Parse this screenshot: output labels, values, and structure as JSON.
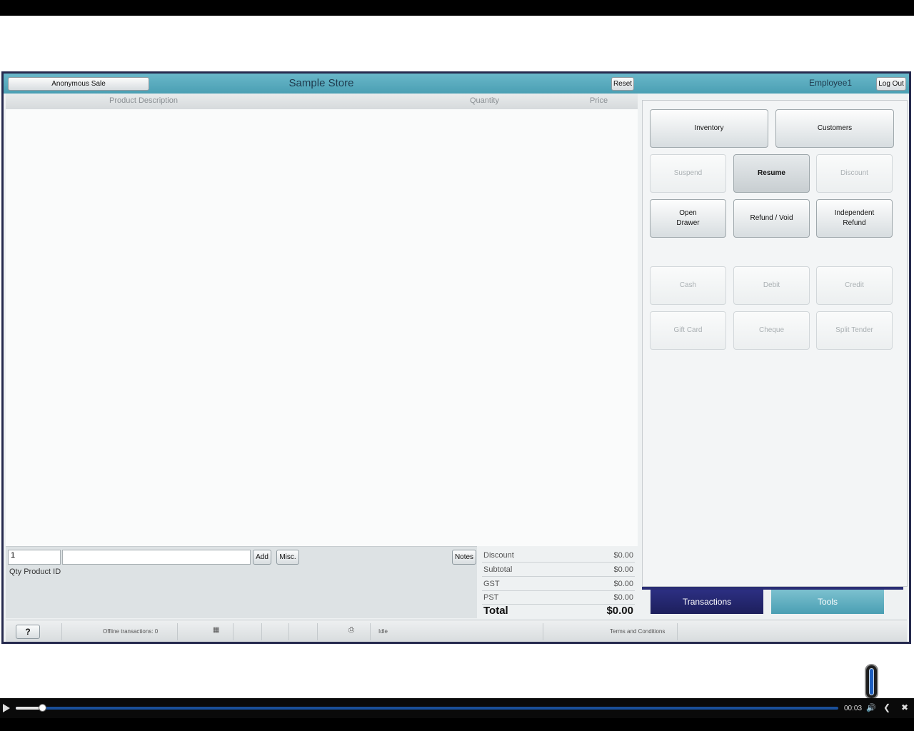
{
  "header": {
    "anonymous_sale": "Anonymous Sale",
    "store_name": "Sample Store",
    "reset": "Reset",
    "employee": "Employee1",
    "logout": "Log Out"
  },
  "columns": {
    "description": "Product Description",
    "quantity": "Quantity",
    "price": "Price"
  },
  "entry": {
    "qty_value": "1",
    "product_value": "",
    "add": "Add",
    "misc": "Misc.",
    "notes": "Notes",
    "qty_label": "Qty",
    "product_label": "Product ID"
  },
  "totals": [
    {
      "label": "Discount",
      "value": "$0.00"
    },
    {
      "label": "Subtotal",
      "value": "$0.00"
    },
    {
      "label": "GST",
      "value": "$0.00"
    },
    {
      "label": "PST",
      "value": "$0.00"
    },
    {
      "label": "Total",
      "value": "$0.00"
    }
  ],
  "panel": {
    "inventory": "Inventory",
    "customers": "Customers",
    "suspend": "Suspend",
    "resume": "Resume",
    "discount": "Discount",
    "open_drawer_1": "Open",
    "open_drawer_2": "Drawer",
    "refund_void": "Refund / Void",
    "independent_refund_1": "Independent",
    "independent_refund_2": "Refund",
    "cash": "Cash",
    "debit": "Debit",
    "credit": "Credit",
    "gift_card": "Gift Card",
    "cheque": "Cheque",
    "split_tender": "Split Tender"
  },
  "tabs": {
    "transactions": "Transactions",
    "tools": "Tools"
  },
  "statusbar": {
    "help": "?",
    "offline": "Offline transactions: 0",
    "state": "Idle",
    "terms": "Terms and Conditions"
  },
  "player": {
    "timecode": "00:03",
    "progress": 0.033
  }
}
